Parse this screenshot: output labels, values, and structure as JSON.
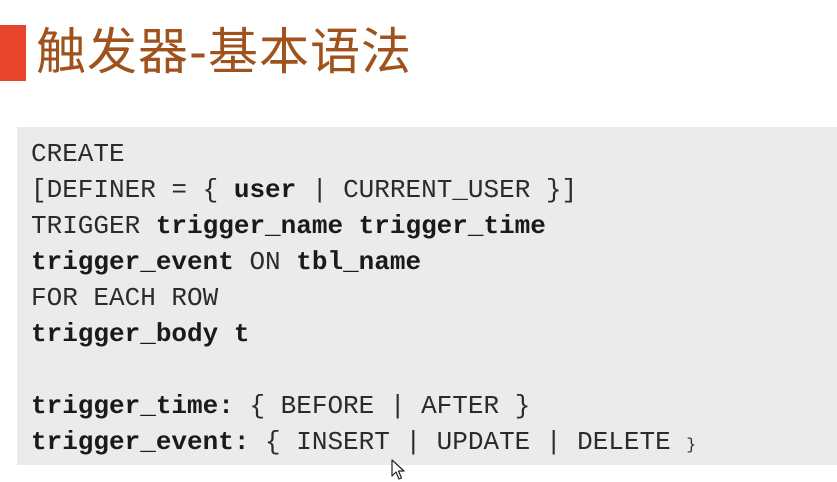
{
  "slide": {
    "title": "触发器-基本语法",
    "accent_color": "#e8452c",
    "title_color": "#a0521d"
  },
  "code": {
    "line1": "CREATE",
    "line2_a": "[DEFINER = { ",
    "line2_b": "user",
    "line2_c": " | CURRENT_USER }]",
    "line3_a": "TRIGGER ",
    "line3_b": "trigger_name trigger_time",
    "line4_a": "trigger_event",
    "line4_b": " ON ",
    "line4_c": "tbl_name",
    "line5": "FOR EACH ROW",
    "line6": "trigger_body t",
    "line8_a": "trigger_time:",
    "line8_b": " { BEFORE | AFTER }",
    "line9_a": "trigger_event:",
    "line9_b": " { INSERT | UPDATE | DELETE ",
    "line9_c": "}"
  },
  "cursor": {
    "icon": "mouse-pointer-icon"
  }
}
